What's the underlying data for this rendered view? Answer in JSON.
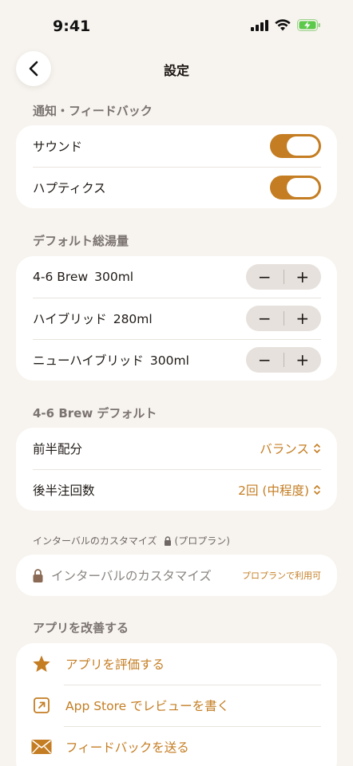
{
  "status_bar": {
    "time": "9:41",
    "icons": [
      "cellular-icon",
      "wifi-icon",
      "battery-charging-icon"
    ]
  },
  "nav": {
    "title": "設定",
    "back_icon": "chevron-left-icon"
  },
  "notifications": {
    "header": "通知・フィードバック",
    "rows": [
      {
        "label": "サウンド",
        "on": true
      },
      {
        "label": "ハプティクス",
        "on": true
      }
    ]
  },
  "default_water": {
    "header": "デフォルト総湯量",
    "rows": [
      {
        "label": "4-6 Brew",
        "value": "300ml"
      },
      {
        "label": "ハイブリッド",
        "value": "280ml"
      },
      {
        "label": "ニューハイブリッド",
        "value": "300ml"
      }
    ],
    "minus": "−",
    "plus": "+"
  },
  "brew_default": {
    "header": "4-6 Brew デフォルト",
    "rows": [
      {
        "label": "前半配分",
        "value": "バランス"
      },
      {
        "label": "後半注回数",
        "value": "2回 (中程度)"
      }
    ]
  },
  "interval": {
    "header": "インターバルのカスタマイズ",
    "header_suffix": "(プロプラン)",
    "row_label": "インターバルのカスタマイズ",
    "badge": "プロプランで利用可"
  },
  "improve": {
    "header": "アプリを改善する",
    "rows": [
      {
        "label": "アプリを評価する",
        "icon": "star-icon"
      },
      {
        "label": "App Store でレビューを書く",
        "icon": "external-link-icon"
      },
      {
        "label": "フィードバックを送る",
        "icon": "envelope-icon"
      }
    ]
  },
  "colors": {
    "accent": "#c47d22",
    "background": "#f7f3ee",
    "card": "#ffffff"
  }
}
